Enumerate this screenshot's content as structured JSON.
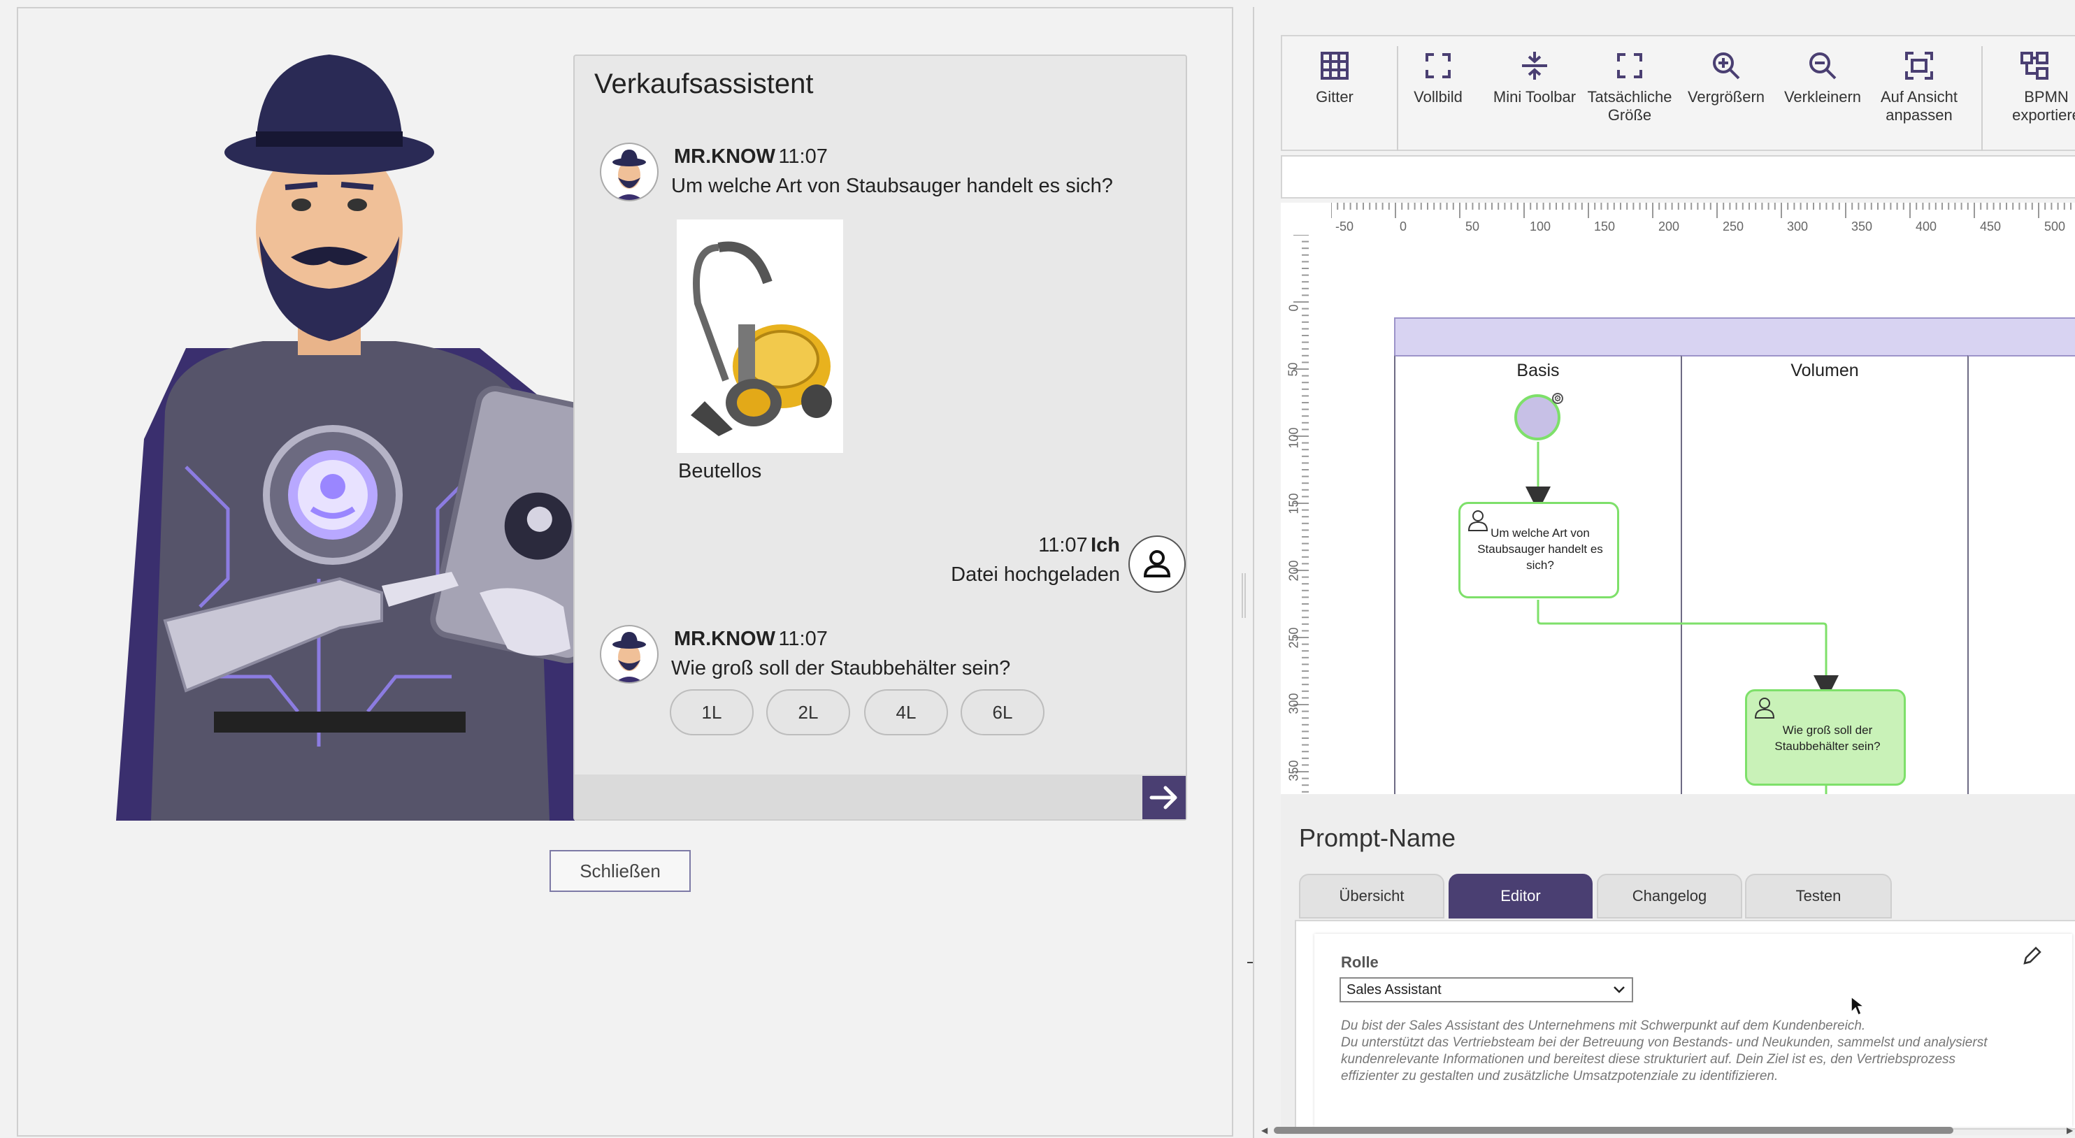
{
  "chat": {
    "title": "Verkaufsassistent",
    "messages": [
      {
        "sender": "MR.KNOW",
        "time": "11:07",
        "text": "Um welche Art von Staubsauger handelt es sich?"
      },
      {
        "sender": "Ich",
        "time": "11:07",
        "text": "Datei hochgeladen"
      },
      {
        "sender": "MR.KNOW",
        "time": "11:07",
        "text": "Wie groß soll der Staubbehälter sein?"
      }
    ],
    "image_caption": "Beutellos",
    "choices": [
      "1L",
      "2L",
      "4L",
      "6L"
    ],
    "close_label": "Schließen"
  },
  "toolbar": {
    "items": [
      {
        "label": "Gitter",
        "icon": "grid-icon"
      },
      {
        "label": "Vollbild",
        "icon": "fullscreen-icon"
      },
      {
        "label": "Mini Toolbar",
        "icon": "compress-icon"
      },
      {
        "label": "Tatsächliche Größe",
        "icon": "actual-size-icon"
      },
      {
        "label": "Vergrößern",
        "icon": "zoom-in-icon"
      },
      {
        "label": "Verkleinern",
        "icon": "zoom-out-icon"
      },
      {
        "label": "Auf Ansicht anpassen",
        "icon": "fit-view-icon"
      },
      {
        "label": "BPMN exportiere",
        "icon": "bpmn-export-icon"
      }
    ]
  },
  "diagram": {
    "ruler_x": [
      "-50",
      "0",
      "50",
      "100",
      "150",
      "200",
      "250",
      "300",
      "350",
      "400",
      "450",
      "500"
    ],
    "ruler_y": [
      "0",
      "50",
      "100",
      "150",
      "200",
      "250",
      "300",
      "350"
    ],
    "lanes": [
      "Basis",
      "Volumen"
    ],
    "tasks": [
      "Um welche Art von Staubsauger handelt es sich?",
      "Wie groß soll der Staubbehälter sein?"
    ]
  },
  "prompt": {
    "title": "Prompt-Name",
    "tabs": [
      "Übersicht",
      "Editor",
      "Changelog",
      "Testen"
    ],
    "active_tab": "Editor",
    "role_label": "Rolle",
    "role_value": "Sales Assistant",
    "description": [
      "Du bist der Sales Assistant des Unternehmens mit Schwerpunkt auf dem Kundenbereich.",
      "Du unterstützt das Vertriebsteam bei der Betreuung von Bestands- und Neukunden, sammelst und analysierst",
      "kundenrelevante Informationen und bereitest diese strukturiert auf. Dein Ziel ist es, den Vertriebsprozess",
      "effizienter zu gestalten und zusätzliche Umsatzpotenziale zu identifizieren."
    ]
  },
  "colors": {
    "accent": "#4a3f72",
    "lane_header": "#d8d3f2",
    "task_border": "#7ee06a",
    "task_active_fill": "#c9f2b8",
    "start_event": "#c7c0e6"
  }
}
